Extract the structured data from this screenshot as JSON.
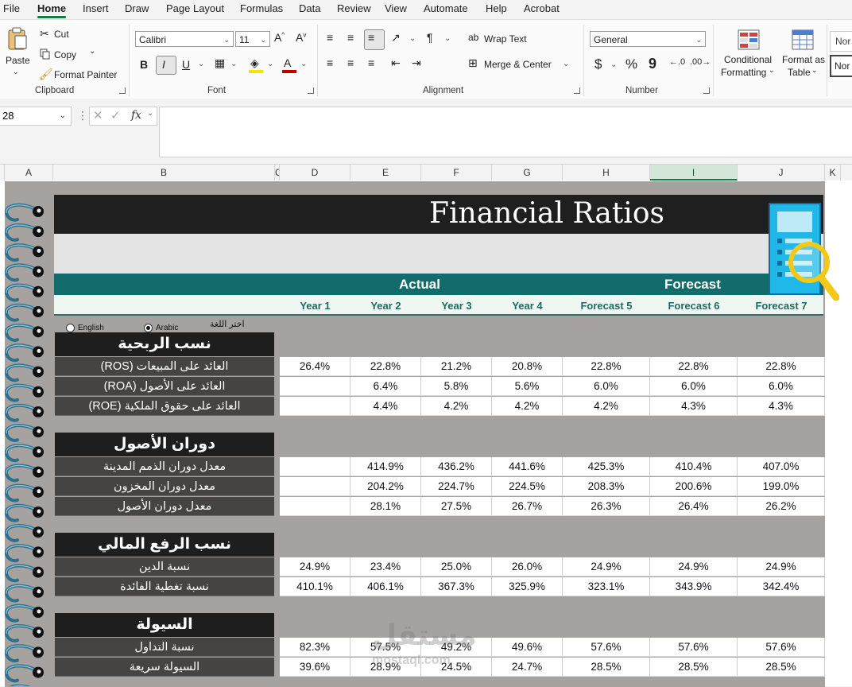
{
  "menu": [
    "File",
    "Home",
    "Insert",
    "Draw",
    "Page Layout",
    "Formulas",
    "Data",
    "Review",
    "View",
    "Automate",
    "Help",
    "Acrobat"
  ],
  "menu_active": "Home",
  "ribbon": {
    "clipboard": {
      "paste": "Paste",
      "cut": "Cut",
      "copy": "Copy",
      "format_painter": "Format Painter",
      "group": "Clipboard"
    },
    "font": {
      "name": "Calibri",
      "size": "11",
      "group": "Font"
    },
    "alignment": {
      "wrap": "Wrap Text",
      "merge": "Merge & Center",
      "group": "Alignment"
    },
    "number": {
      "format": "General",
      "group": "Number",
      "currency": "$",
      "percent": "%",
      "comma": "9"
    },
    "styles": {
      "conditional_line1": "Conditional",
      "conditional_line2": "Formatting",
      "format_table_line1": "Format as",
      "format_table_line2": "Table",
      "style_top": "Nor",
      "style_bottom": "Nor"
    }
  },
  "formula_bar": {
    "name_box": "28",
    "fx": "fx",
    "value": ""
  },
  "columns": [
    "A",
    "B",
    "C",
    "D",
    "E",
    "F",
    "G",
    "H",
    "I",
    "J",
    "K"
  ],
  "selected_column": "I",
  "sheet": {
    "title": "Financial Ratios",
    "band_actual": "Actual",
    "band_forecast": "Forecast",
    "years": [
      "Year 1",
      "Year 2",
      "Year 3",
      "Year 4",
      "Forecast 5",
      "Forecast 6",
      "Forecast 7"
    ],
    "lang": {
      "english": "English",
      "arabic": "Arabic",
      "choose": "اختر اللغة",
      "selected": "Arabic"
    },
    "sections": [
      {
        "title": "نسب الربحية",
        "rows": [
          {
            "label": "العائد على المبيعات (ROS)",
            "values": [
              "26.4%",
              "22.8%",
              "21.2%",
              "20.8%",
              "22.8%",
              "22.8%",
              "22.8%"
            ]
          },
          {
            "label": "العائد على الأصول (ROA)",
            "values": [
              "",
              "6.4%",
              "5.8%",
              "5.6%",
              "6.0%",
              "6.0%",
              "6.0%"
            ]
          },
          {
            "label": "العائد على حقوق الملكية (ROE)",
            "values": [
              "",
              "4.4%",
              "4.2%",
              "4.2%",
              "4.2%",
              "4.3%",
              "4.3%"
            ]
          }
        ]
      },
      {
        "title": "دوران الأصول",
        "rows": [
          {
            "label": "معدل دوران الذمم المدينة",
            "values": [
              "",
              "414.9%",
              "436.2%",
              "441.6%",
              "425.3%",
              "410.4%",
              "407.0%"
            ]
          },
          {
            "label": "معدل دوران المخزون",
            "values": [
              "",
              "204.2%",
              "224.7%",
              "224.5%",
              "208.3%",
              "200.6%",
              "199.0%"
            ]
          },
          {
            "label": "معدل دوران الأصول",
            "values": [
              "",
              "28.1%",
              "27.5%",
              "26.7%",
              "26.3%",
              "26.4%",
              "26.2%"
            ]
          }
        ]
      },
      {
        "title": "نسب الرفع المالي",
        "rows": [
          {
            "label": "نسبة الدين",
            "values": [
              "24.9%",
              "23.4%",
              "25.0%",
              "26.0%",
              "24.9%",
              "24.9%",
              "24.9%"
            ]
          },
          {
            "label": "نسبة تغطية الفائدة",
            "values": [
              "410.1%",
              "406.1%",
              "367.3%",
              "325.9%",
              "323.1%",
              "343.9%",
              "342.4%"
            ]
          }
        ]
      },
      {
        "title": "السيولة",
        "rows": [
          {
            "label": "نسبة التداول",
            "values": [
              "82.3%",
              "57.5%",
              "49.2%",
              "49.6%",
              "57.6%",
              "57.6%",
              "57.6%"
            ]
          },
          {
            "label": "السيولة سريعة",
            "values": [
              "39.6%",
              "28.9%",
              "24.5%",
              "24.7%",
              "28.5%",
              "28.5%",
              "28.5%"
            ]
          }
        ]
      }
    ],
    "watermark": "مستقل",
    "watermark_sub": "mostaql.com"
  },
  "colors": {
    "teal": "#146b6b",
    "dark": "#1f1f1f",
    "label_bg": "#454443",
    "sheet_bg": "#a5a2a0",
    "excel_green": "#107c41"
  }
}
